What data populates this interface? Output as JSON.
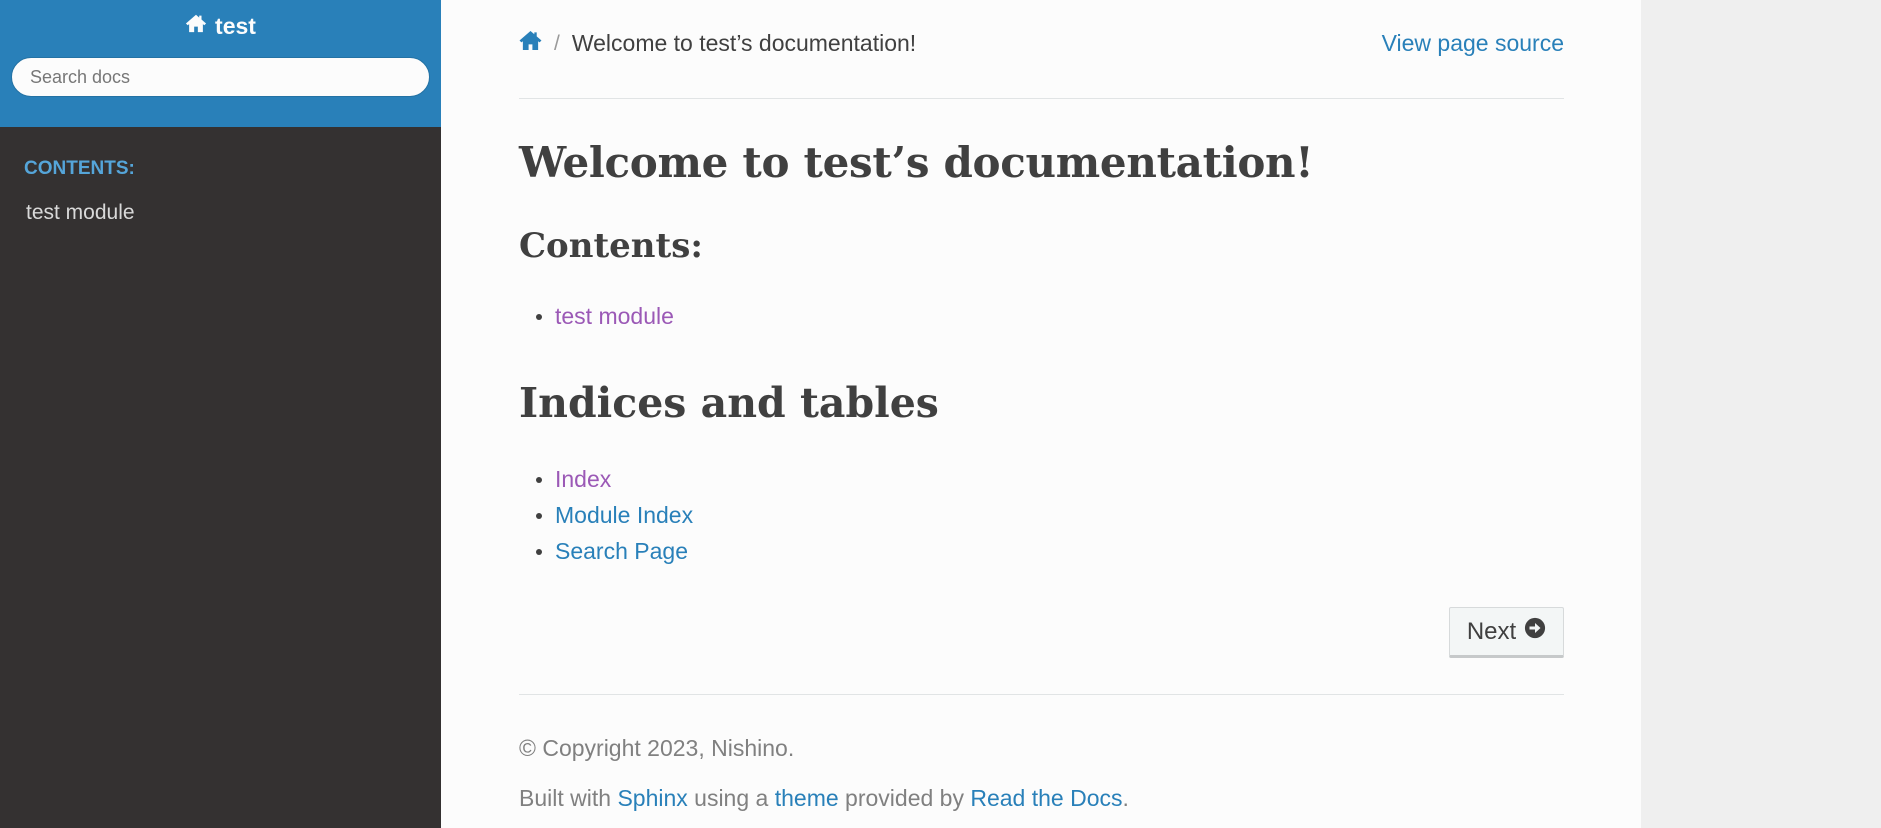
{
  "sidebar": {
    "project_name": "test",
    "search_placeholder": "Search docs",
    "caption": "Contents:",
    "items": [
      {
        "label": "test module"
      }
    ]
  },
  "breadcrumbs": {
    "current": "Welcome to test’s documentation!",
    "view_source": "View page source"
  },
  "main": {
    "title": "Welcome to test’s documentation!",
    "contents_heading": "Contents:",
    "contents_links": [
      {
        "label": "test module"
      }
    ],
    "indices_heading": "Indices and tables",
    "indices_links": [
      {
        "label": "Index"
      },
      {
        "label": "Module Index"
      },
      {
        "label": "Search Page"
      }
    ],
    "next_label": "Next"
  },
  "footer": {
    "copyright": "© Copyright 2023, Nishino.",
    "built_with": "Built with",
    "sphinx": "Sphinx",
    "using_a": "using a",
    "theme": "theme",
    "provided_by": "provided by",
    "rtd": "Read the Docs",
    "period": "."
  },
  "colors": {
    "accent": "#2980b9",
    "sidebar_bg": "#343131",
    "visited_link": "#9b59b6",
    "caption": "#55a5d9"
  },
  "icons": {
    "project": "home-icon",
    "breadcrumb_home": "home-icon",
    "next": "circle-arrow-right-icon"
  }
}
